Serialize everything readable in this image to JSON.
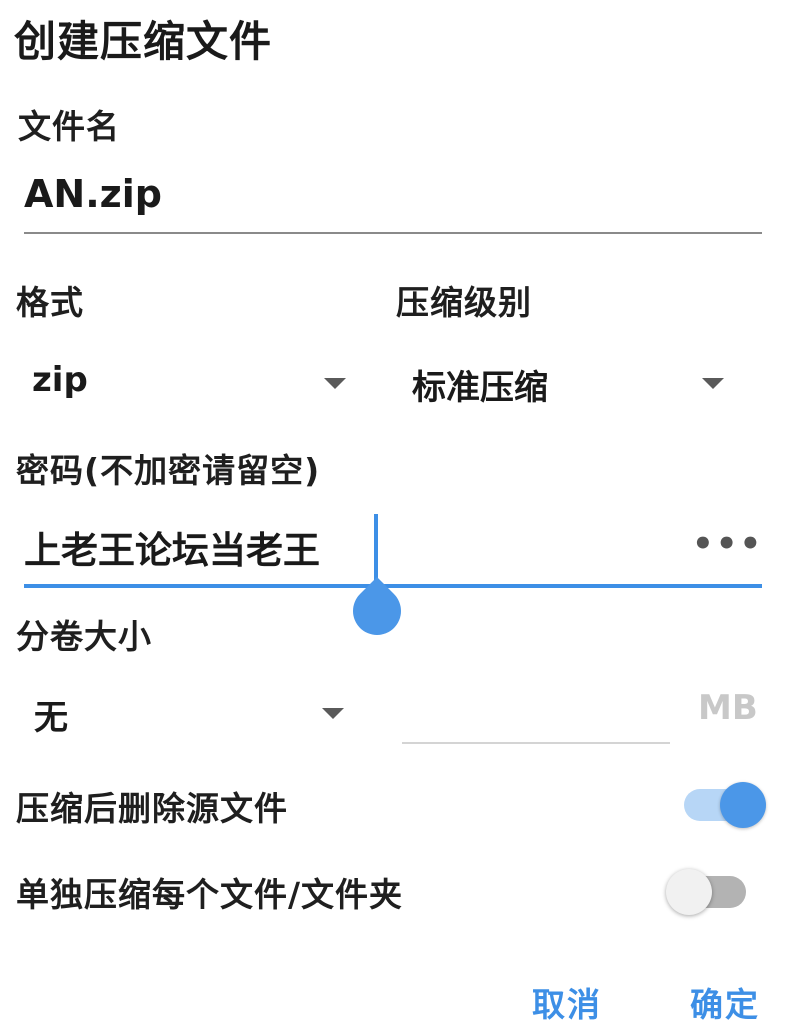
{
  "dialog": {
    "title": "创建压缩文件"
  },
  "filename": {
    "label": "文件名",
    "value": "AN.zip"
  },
  "format": {
    "label": "格式",
    "selected": "zip"
  },
  "level": {
    "label": "压缩级别",
    "selected": "标准压缩"
  },
  "password": {
    "label": "密码(不加密请留空)",
    "value": "上老王论坛当老王",
    "toggle_icon": "more-dots-icon",
    "toggle_text": "•••"
  },
  "volume": {
    "label": "分卷大小",
    "selected": "无",
    "size_value": "",
    "unit": "MB"
  },
  "options": {
    "delete_source_label": "压缩后删除源文件",
    "delete_source_on": true,
    "each_separately_label": "单独压缩每个文件/文件夹",
    "each_separately_on": false
  },
  "actions": {
    "cancel_label": "取消",
    "confirm_label": "确定"
  },
  "colors": {
    "accent": "#3d8fe6"
  }
}
